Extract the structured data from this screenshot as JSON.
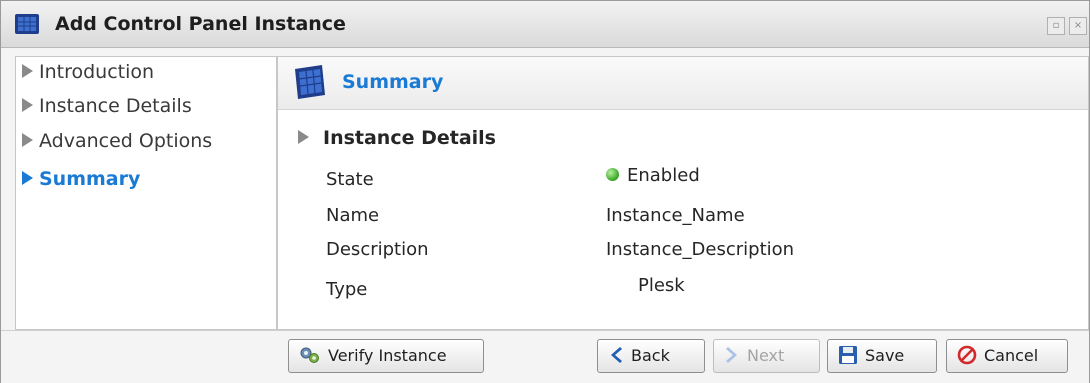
{
  "window": {
    "title": "Add Control Panel Instance"
  },
  "sidebar": {
    "items": [
      {
        "label": "Introduction"
      },
      {
        "label": "Instance Details"
      },
      {
        "label": "Advanced Options"
      },
      {
        "label": "Summary"
      }
    ]
  },
  "content": {
    "header": "Summary",
    "section": "Instance Details",
    "fields": {
      "state": {
        "label": "State",
        "value": "Enabled"
      },
      "name": {
        "label": "Name",
        "value": "Instance_Name"
      },
      "description": {
        "label": "Description",
        "value": "Instance_Description"
      },
      "type": {
        "label": "Type",
        "value": "Plesk"
      }
    }
  },
  "footer": {
    "verify": "Verify Instance",
    "back": "Back",
    "next": "Next",
    "save": "Save",
    "cancel": "Cancel"
  },
  "colors": {
    "accent": "#1a7ad4",
    "status_enabled": "#3caa2a",
    "cancel_red": "#d22a2a"
  }
}
